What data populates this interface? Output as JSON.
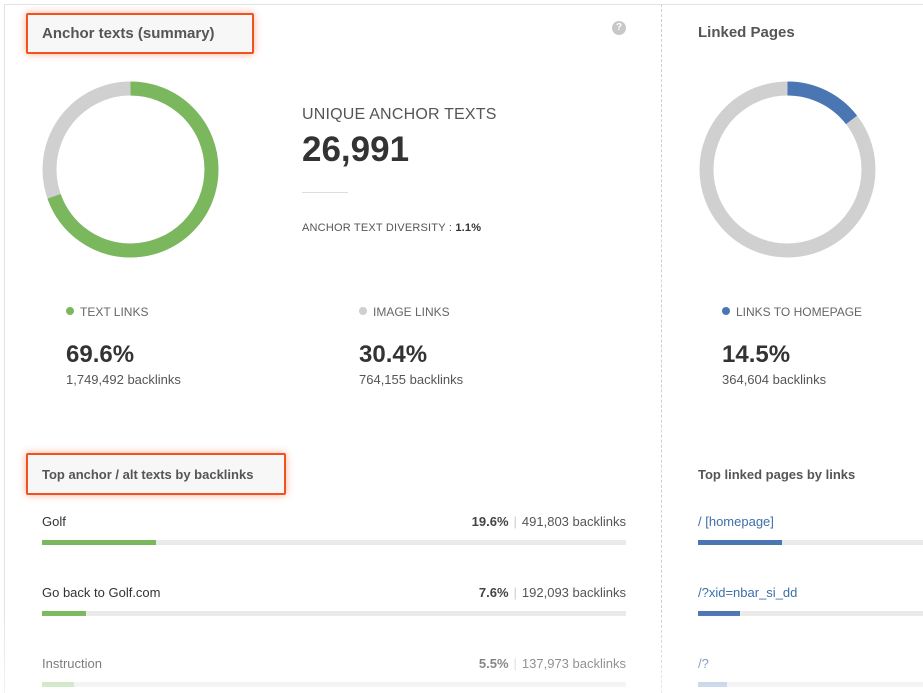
{
  "summary": {
    "title": "Anchor texts (summary)",
    "help_icon": "?",
    "unique_label": "UNIQUE ANCHOR TEXTS",
    "unique_value": "26,991",
    "diversity_label": "ANCHOR TEXT DIVERSITY :",
    "diversity_value": "1.1%",
    "donut_fraction": 0.696,
    "text_links": {
      "label": "TEXT LINKS",
      "pct": "69.6%",
      "backlinks": "1,749,492 backlinks",
      "color": "#7ab75d"
    },
    "image_links": {
      "label": "IMAGE LINKS",
      "pct": "30.4%",
      "backlinks": "764,155 backlinks",
      "color": "#cfcfcf"
    }
  },
  "top_anchors": {
    "title": "Top anchor / alt texts by backlinks",
    "rows": [
      {
        "label": "Golf",
        "pct": "19.6%",
        "backlinks": "491,803 backlinks",
        "fraction": 0.196
      },
      {
        "label": "Go back to Golf.com",
        "pct": "7.6%",
        "backlinks": "192,093 backlinks",
        "fraction": 0.076
      },
      {
        "label": "Instruction",
        "pct": "5.5%",
        "backlinks": "137,973 backlinks",
        "fraction": 0.055
      }
    ]
  },
  "linked_pages": {
    "title": "Linked Pages",
    "donut_fraction": 0.145,
    "homepage": {
      "label": "LINKS TO HOMEPAGE",
      "pct": "14.5%",
      "backlinks": "364,604 backlinks",
      "color": "#4a76b3"
    },
    "top_title": "Top linked pages by links",
    "rows": [
      {
        "label": "/ [homepage]",
        "fraction": 0.145
      },
      {
        "label": "/?xid=nbar_si_dd",
        "fraction": 0.073
      },
      {
        "label": "/?",
        "fraction": 0.05
      }
    ]
  }
}
